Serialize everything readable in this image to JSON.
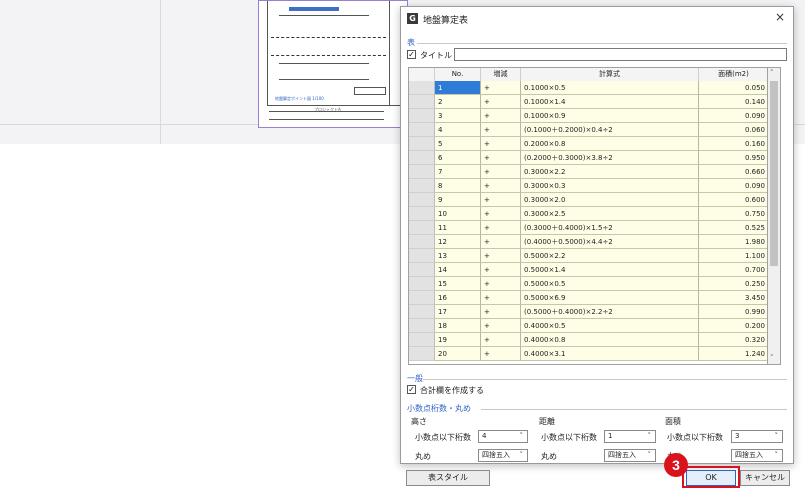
{
  "background_drawing": {
    "project_label": "プロジェクトA",
    "caption": "地盤算定ポイント図 1/100"
  },
  "dialog": {
    "icon_letter": "G",
    "title": "地盤算定表",
    "close": "×",
    "table_group": {
      "label": "表",
      "title_checkbox_checked": "✓",
      "title_label": "タイトル",
      "title_value": "",
      "columns": [
        "No.",
        "増減",
        "計算式",
        "面積(m2)"
      ],
      "rows": [
        {
          "no": "1",
          "sign": "+",
          "expr": "0.1000×0.5",
          "area": "0.050"
        },
        {
          "no": "2",
          "sign": "+",
          "expr": "0.1000×1.4",
          "area": "0.140"
        },
        {
          "no": "3",
          "sign": "+",
          "expr": "0.1000×0.9",
          "area": "0.090"
        },
        {
          "no": "4",
          "sign": "+",
          "expr": "(0.1000＋0.2000)×0.4÷2",
          "area": "0.060"
        },
        {
          "no": "5",
          "sign": "+",
          "expr": "0.2000×0.8",
          "area": "0.160"
        },
        {
          "no": "6",
          "sign": "+",
          "expr": "(0.2000＋0.3000)×3.8÷2",
          "area": "0.950"
        },
        {
          "no": "7",
          "sign": "+",
          "expr": "0.3000×2.2",
          "area": "0.660"
        },
        {
          "no": "8",
          "sign": "+",
          "expr": "0.3000×0.3",
          "area": "0.090"
        },
        {
          "no": "9",
          "sign": "+",
          "expr": "0.3000×2.0",
          "area": "0.600"
        },
        {
          "no": "10",
          "sign": "+",
          "expr": "0.3000×2.5",
          "area": "0.750"
        },
        {
          "no": "11",
          "sign": "+",
          "expr": "(0.3000＋0.4000)×1.5÷2",
          "area": "0.525"
        },
        {
          "no": "12",
          "sign": "+",
          "expr": "(0.4000＋0.5000)×4.4÷2",
          "area": "1.980"
        },
        {
          "no": "13",
          "sign": "+",
          "expr": "0.5000×2.2",
          "area": "1.100"
        },
        {
          "no": "14",
          "sign": "+",
          "expr": "0.5000×1.4",
          "area": "0.700"
        },
        {
          "no": "15",
          "sign": "+",
          "expr": "0.5000×0.5",
          "area": "0.250"
        },
        {
          "no": "16",
          "sign": "+",
          "expr": "0.5000×6.9",
          "area": "3.450"
        },
        {
          "no": "17",
          "sign": "+",
          "expr": "(0.5000＋0.4000)×2.2÷2",
          "area": "0.990"
        },
        {
          "no": "18",
          "sign": "+",
          "expr": "0.4000×0.5",
          "area": "0.200"
        },
        {
          "no": "19",
          "sign": "+",
          "expr": "0.4000×0.8",
          "area": "0.320"
        },
        {
          "no": "20",
          "sign": "+",
          "expr": "0.4000×3.1",
          "area": "1.240"
        }
      ]
    },
    "general_group": {
      "label": "一般",
      "total_checkbox_checked": "✓",
      "total_label": "合計欄を作成する"
    },
    "decimal_group": {
      "label": "小数点桁数・丸め",
      "height": {
        "label": "高さ",
        "digits_label": "小数点以下桁数",
        "digits_value": "4",
        "round_label": "丸め",
        "round_value": "四捨五入"
      },
      "distance": {
        "label": "距離",
        "digits_label": "小数点以下桁数",
        "digits_value": "1",
        "round_label": "丸め",
        "round_value": "四捨五入"
      },
      "area": {
        "label": "面積",
        "digits_label": "小数点以下桁数",
        "digits_value": "3",
        "round_label": "丸め",
        "round_value": "四捨五入"
      }
    },
    "buttons": {
      "style": "表スタイル",
      "ok": "OK",
      "cancel": "キャンセル"
    }
  },
  "callout": {
    "step": "3",
    "color": "#d8131b"
  }
}
